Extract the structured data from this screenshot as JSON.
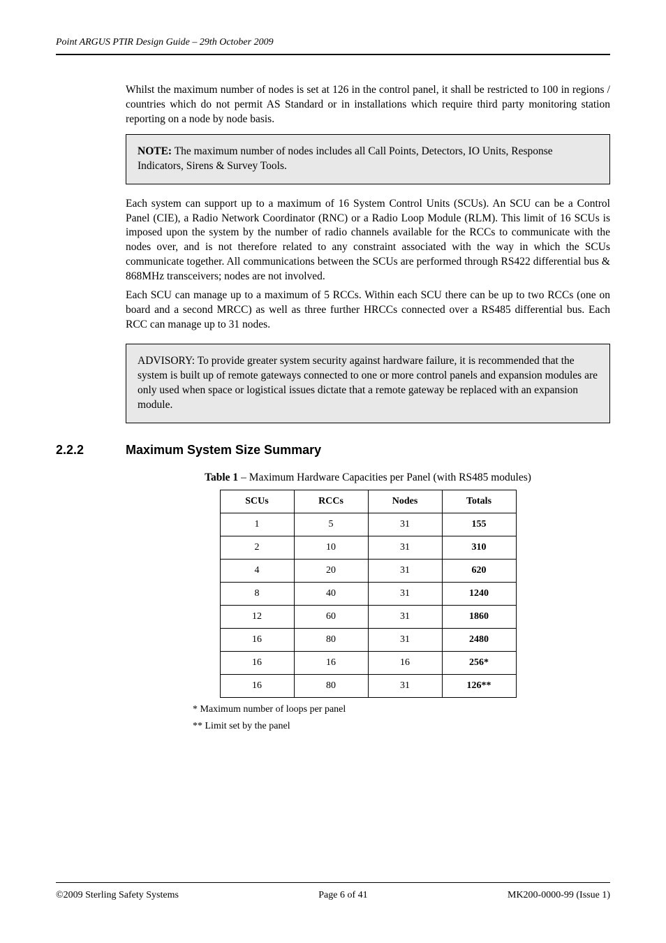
{
  "header": {
    "title": "Point ARGUS PTIR Design Guide – 29th October 2009"
  },
  "para1": "Whilst the maximum number of nodes is set at 126 in the control panel, it shall be restricted to 100 in regions / countries which do not permit AS Standard or in installations which require third party monitoring station reporting on a node by node basis.",
  "noteA": {
    "strong": "NOTE:",
    "remainder": "The maximum number of nodes includes all Call Points, Detectors, IO Units, Response Indicators, Sirens & Survey Tools."
  },
  "para2": "Each system can support up to a maximum of 16 System Control Units (SCUs). An SCU can be a Control Panel (CIE), a Radio Network Coordinator (RNC) or a Radio Loop Module (RLM). This limit of 16 SCUs is imposed upon the system by the number of radio channels available for the RCCs to communicate with the nodes over, and is not therefore related to any constraint associated with the way in which the SCUs communicate together. All communications between the SCUs are performed through RS422 differential bus & 868MHz transceivers; nodes are not involved.",
  "para3": "Each SCU can manage up to a maximum of 5 RCCs. Within each SCU there can be up to two RCCs (one on board and a second MRCC) as well as three further HRCCs connected over a RS485 differential bus. Each RCC can manage up to 31 nodes.",
  "noteB": {
    "strong": "ADVISORY:",
    "line1": "To provide greater system security against hardware failure, it is recommended that the system is built up of remote gateways connected to one or more control panels and expansion modules are only used when space or logistical issues dictate that a remote gateway be replaced with an expansion module."
  },
  "subsection_number": "2.2.2",
  "subsection_title": "Maximum System Size Summary",
  "table_caption_label": "Table 1",
  "table_caption_text": "Maximum Hardware Capacities per Panel (with RS485 modules)",
  "chart_data": {
    "type": "table",
    "columns": [
      "SCUs",
      "RCCs",
      "Nodes",
      "Totals"
    ],
    "rows": [
      [
        "1",
        "5",
        "31",
        "155"
      ],
      [
        "2",
        "10",
        "31",
        "310"
      ],
      [
        "4",
        "20",
        "31",
        "620"
      ],
      [
        "8",
        "40",
        "31",
        "1240"
      ],
      [
        "12",
        "60",
        "31",
        "1860"
      ],
      [
        "16",
        "80",
        "31",
        "2480"
      ],
      [
        "16",
        "16",
        "16",
        "256*"
      ],
      [
        "16",
        "80",
        "31",
        "126**"
      ]
    ],
    "title": "Maximum Hardware Capacities per Panel (with RS485 modules)"
  },
  "footnote1": "*   Maximum number of loops per panel",
  "footnote2": "**  Limit set by the panel",
  "footer": {
    "left": "©2009 Sterling Safety Systems",
    "center": "Page 6 of 41",
    "right": "MK200-0000-99 (Issue 1)"
  }
}
